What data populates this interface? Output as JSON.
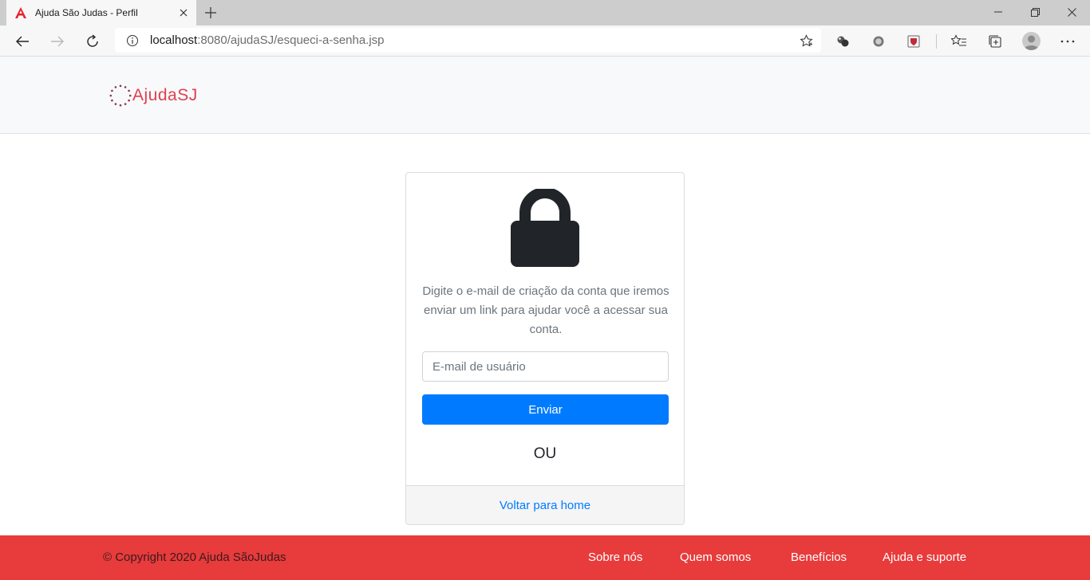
{
  "browser": {
    "tab_title": "Ajuda São Judas - Perfil",
    "url_host": "localhost",
    "url_rest": ":8080/ajudaSJ/esqueci-a-senha.jsp"
  },
  "header": {
    "brand": "AjudaSJ"
  },
  "card": {
    "description": "Digite o e-mail de criação da conta que iremos enviar um link para ajudar você a acessar sua conta.",
    "email_placeholder": "E-mail de usuário",
    "submit_label": "Enviar",
    "separator": "OU",
    "back_link": "Voltar para home"
  },
  "footer": {
    "copyright": "© Copyright 2020 Ajuda SãoJudas",
    "links": [
      "Sobre nós",
      "Quem somos",
      "Benefícios",
      "Ajuda e suporte"
    ]
  },
  "colors": {
    "brand": "#e03f4f",
    "primary": "#007bff",
    "footer": "#e83b3c"
  }
}
